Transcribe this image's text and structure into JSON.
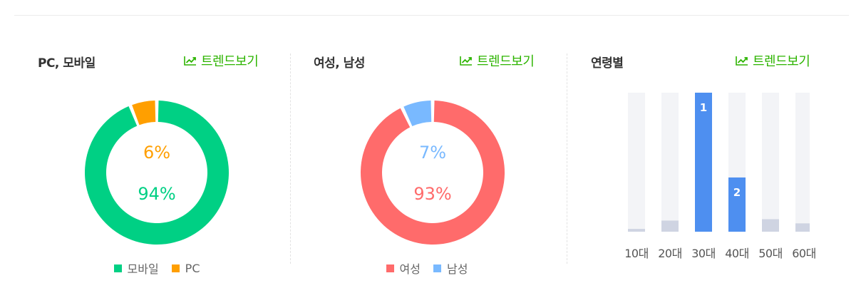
{
  "panels": {
    "device": {
      "title": "PC, 모바일",
      "trend_label": "트렌드보기",
      "legend": [
        {
          "label": "모바일",
          "color": "#00d084"
        },
        {
          "label": "PC",
          "color": "#ff9f00"
        }
      ]
    },
    "gender": {
      "title": "여성, 남성",
      "trend_label": "트렌드보기",
      "legend": [
        {
          "label": "여성",
          "color": "#ff6b6b"
        },
        {
          "label": "남성",
          "color": "#79b9ff"
        }
      ]
    },
    "age": {
      "title": "연령별",
      "trend_label": "트렌드보기"
    }
  },
  "chart_data": [
    {
      "type": "pie",
      "donut": true,
      "slices": [
        {
          "label": "모바일",
          "value": 94,
          "display": "94%",
          "color": "#00d084"
        },
        {
          "label": "PC",
          "value": 6,
          "display": "6%",
          "color": "#ff9f00"
        }
      ]
    },
    {
      "type": "pie",
      "donut": true,
      "slices": [
        {
          "label": "여성",
          "value": 93,
          "display": "93%",
          "color": "#ff6b6b"
        },
        {
          "label": "남성",
          "value": 7,
          "display": "7%",
          "color": "#79b9ff"
        }
      ]
    },
    {
      "type": "bar",
      "categories": [
        "10대",
        "20대",
        "30대",
        "40대",
        "50대",
        "60대"
      ],
      "values": [
        2,
        8,
        100,
        39,
        9,
        6
      ],
      "ylim": [
        0,
        100
      ],
      "rank_labels": [
        "",
        "",
        "1",
        "2",
        "",
        ""
      ],
      "highlight_color": "#4e8ff0",
      "normal_color": "#cfd4e2",
      "track_color": "#f3f4f7"
    }
  ]
}
